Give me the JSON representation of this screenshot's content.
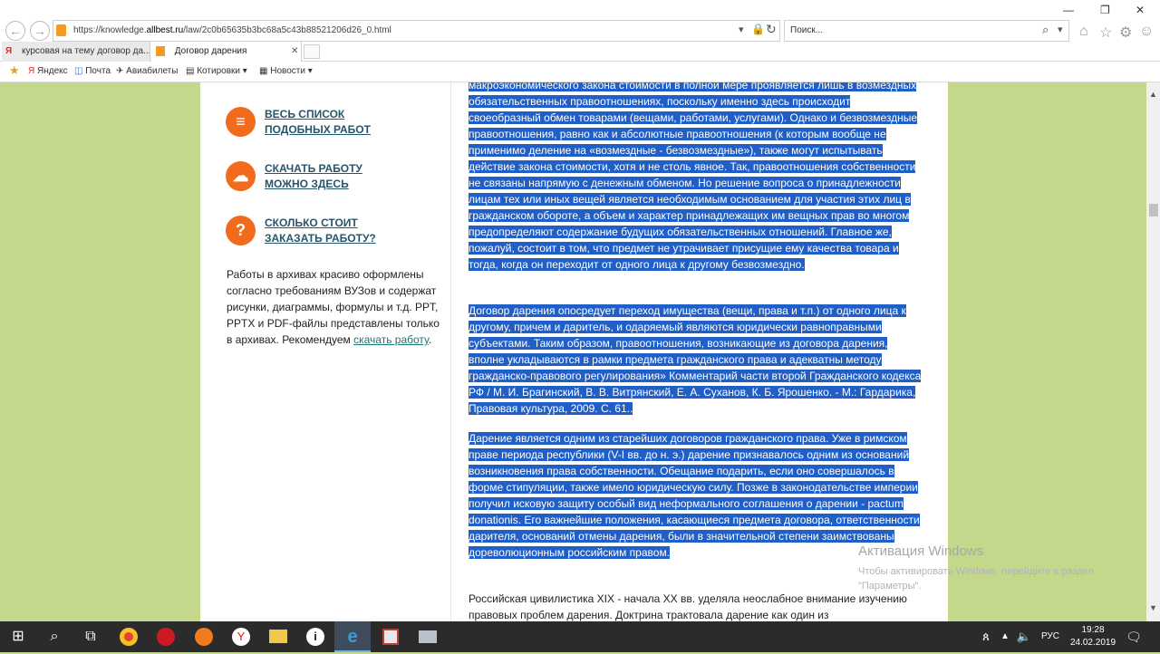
{
  "browser": {
    "url_prefix": "https://knowledge.",
    "url_domain": "allbest.ru",
    "url_path": "/law/2c0b65635b3bc68a5c43b88521206d26_0.html",
    "search_placeholder": "Поиск...",
    "tabs": [
      "курсовая на тему договор да...",
      "Договор дарения"
    ],
    "favorites": [
      "Яндекс",
      "Почта",
      "Авиабилеты",
      "Котировки",
      "Новости"
    ]
  },
  "sidebar": {
    "links": [
      {
        "line1": "ВЕСЬ СПИСОК",
        "line2": "ПОДОБНЫХ РАБОТ",
        "icon": "search-list-icon"
      },
      {
        "line1": "СКАЧАТЬ РАБОТУ",
        "line2": "МОЖНО ЗДЕСЬ",
        "icon": "download-cloud-icon"
      },
      {
        "line1": "СКОЛЬКО СТОИТ",
        "line2": "ЗАКАЗАТЬ РАБОТУ?",
        "icon": "question-icon"
      }
    ],
    "text": "Работы в архивах красиво оформлены согласно требованиям ВУЗов и содержат рисунки, диаграммы, формулы и т.д. PPT, PPTX и PDF-файлы представлены только в архивах. Рекомендуем",
    "link": "скачать работу",
    "tail": "."
  },
  "content": {
    "p1": "макроэкономического закона стоимости в полной мере проявляется лишь в возмездных обязательственных правоотношениях, поскольку именно здесь происходит своеобразный обмен товарами (вещами, работами, услугами). Однако и безвозмездные правоотношения, равно как и абсолютные правоотношения (к которым вообще не применимо деление на «возмездные - безвозмездные»), также могут испытывать действие закона стоимости, хотя и не столь явное. Так, правоотношения собственности не связаны напрямую с денежным обменом. Но решение вопроса о принадлежности лицам тех или иных вещей является необходимым основанием для участия этих лиц в гражданском обороте, а объем и характер принадлежащих им вещных прав во многом предопределяют содержание будущих обязательственных отношений. Главное же, пожалуй, состоит в том, что предмет не утрачивает присущие ему качества товара и тогда, когда он переходит от одного лица к другому безвозмездно.",
    "p2": "Договор дарения опосредует переход имущества (вещи, права и т.п.) от одного лица к другому, причем и даритель, и одаряемый являются юридически равноправными субъектами. Таким образом, правоотношения, возникающие из договора дарения, вполне укладываются в рамки предмета гражданского права и адекватны методу гражданско-правового регулирования» Комментарий части второй Гражданского кодекса РФ / М. И. Брагинский, В. В. Витрянский, Е. А. Суханов, К. Б. Ярошенко. - М.: Гардарика, Правовая культура, 2009. С. 61..",
    "p3": "Дарение является одним из старейших договоров гражданского права. Уже в римском праве периода республики (V-I вв. до н. э.) дарение признавалось одним из оснований возникновения права собственности. Обещание подарить, если оно совершалось в форме стипуляции, также имело юридическую силу. Позже в законодательстве империи получил исковую защиту особый вид неформального соглашения о дарении - pactum donationis. Его важнейшие положения, касающиеся предмета договора, ответственности дарителя, оснований отмены дарения, были в значительной степени заимствованы дореволюционным российским правом.",
    "p4": "Российская цивилистика XIX - начала XX вв. уделяла неослабное внимание изучению правовых проблем дарения. Доктрина трактовала дарение как один из"
  },
  "watermark": {
    "title": "Активация Windows",
    "line1": "Чтобы активировать Windows, перейдите в раздел",
    "line2": "\"Параметры\"."
  },
  "taskbar": {
    "lang": "РУС",
    "time": "19:28",
    "date": "24.02.2019"
  }
}
